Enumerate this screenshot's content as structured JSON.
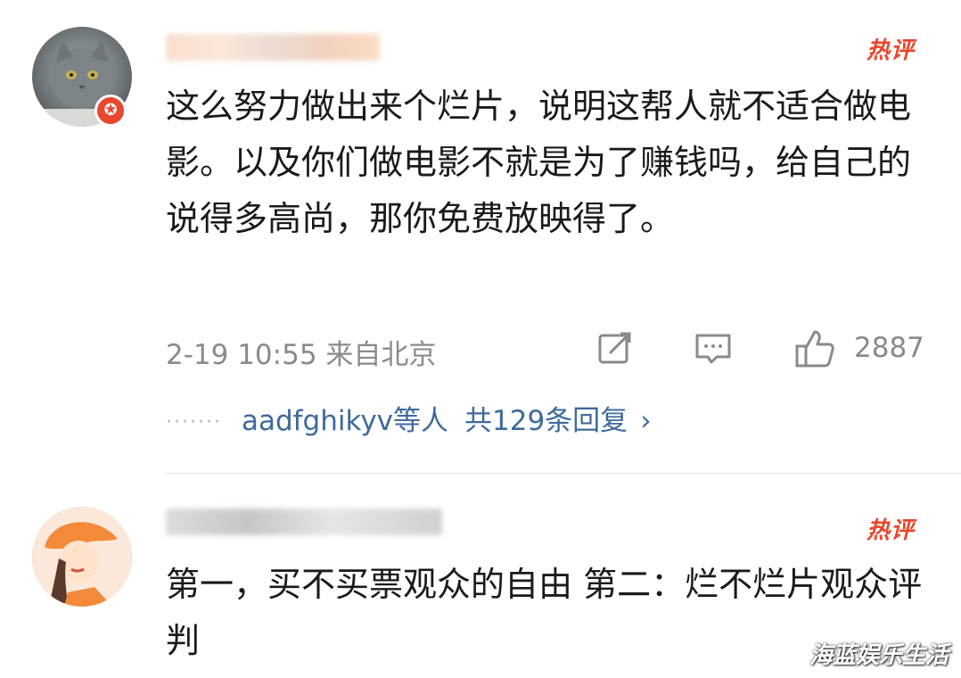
{
  "comments": [
    {
      "badge": "热评",
      "verified_symbol": "✪",
      "text": "这么努力做出来个烂片，说明这帮人就不适合做电影。以及你们做电影不就是为了赚钱吗，给自己的说得多高尚，那你免费放映得了。",
      "time": "2-19 10:55 来自北京",
      "likes": "2887",
      "replies": {
        "dots": "·······",
        "names": "aadfghikyv",
        "suffix": "等人",
        "count": "共129条回复",
        "arrow": "›"
      }
    },
    {
      "badge": "热评",
      "text": "第一，买不买票观众的自由 第二：烂不烂片观众评判"
    }
  ],
  "watermark": "海蓝娱乐生活",
  "colors": {
    "hot": "#e8462b",
    "link": "#3f6a9c",
    "meta": "#8a8a8a"
  }
}
